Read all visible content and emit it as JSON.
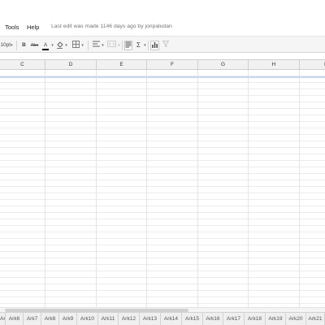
{
  "menubar": {
    "items": [
      "Tools",
      "Help"
    ],
    "last_edit": "Last edit was made 1146 days ago by jonpaludan"
  },
  "toolbar": {
    "font_size": "10pt",
    "bold": "B",
    "strikethrough": "Abc",
    "text_color": "A",
    "sum": "Σ"
  },
  "columns": [
    "C",
    "D",
    "E",
    "F",
    "G",
    "H",
    "I"
  ],
  "sheet_tabs": [
    "Ark5",
    "Ark6",
    "Ark7",
    "Ark8",
    "Ark9",
    "Ark10",
    "Ark11",
    "Ark12",
    "Ark13",
    "Ark14",
    "Ark15",
    "Ark16",
    "Ark17",
    "Ark18",
    "Ark19",
    "Ark20",
    "Ark21"
  ],
  "colors": {
    "text_color_bar": "#000000",
    "selection_row": "#c9d6ee"
  }
}
